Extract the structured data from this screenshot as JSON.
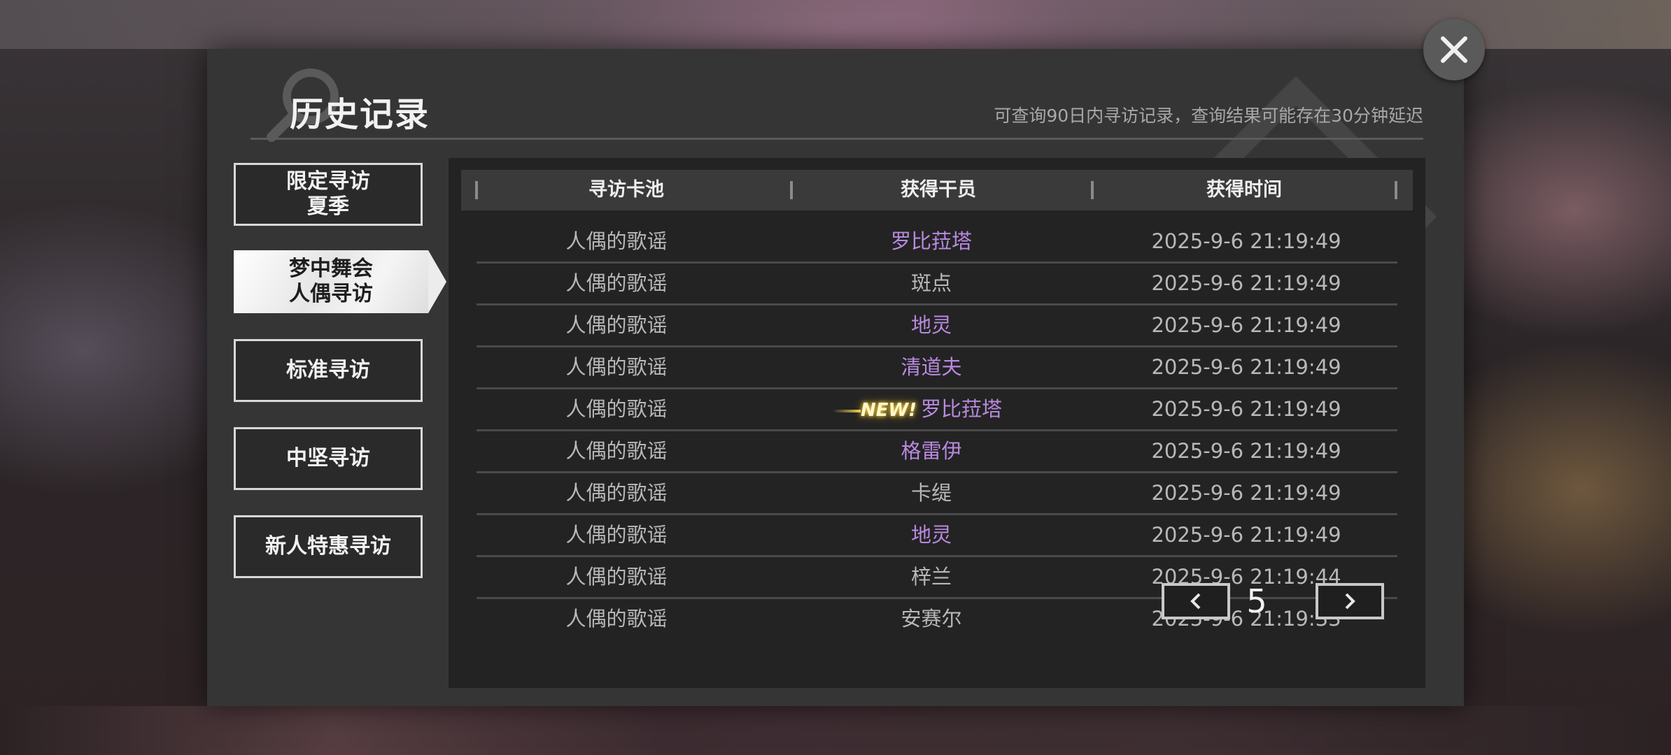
{
  "header": {
    "title": "历史记录",
    "subtitle": "可查询90日内寻访记录，查询结果可能存在30分钟延迟"
  },
  "tabs": [
    {
      "label": "限定寻访\n夏季",
      "active": false
    },
    {
      "label": "梦中舞会\n人偶寻访",
      "active": true
    },
    {
      "label": "标准寻访",
      "active": false
    },
    {
      "label": "中坚寻访",
      "active": false
    },
    {
      "label": "新人特惠寻访",
      "active": false
    }
  ],
  "table": {
    "columns": [
      "寻访卡池",
      "获得干员",
      "获得时间"
    ],
    "rows": [
      {
        "pool": "人偶的歌谣",
        "operator": "罗比菈塔",
        "time": "2025-9-6 21:19:49",
        "highlight": true,
        "new": false
      },
      {
        "pool": "人偶的歌谣",
        "operator": "斑点",
        "time": "2025-9-6 21:19:49",
        "highlight": false,
        "new": false
      },
      {
        "pool": "人偶的歌谣",
        "operator": "地灵",
        "time": "2025-9-6 21:19:49",
        "highlight": true,
        "new": false
      },
      {
        "pool": "人偶的歌谣",
        "operator": "清道夫",
        "time": "2025-9-6 21:19:49",
        "highlight": true,
        "new": false
      },
      {
        "pool": "人偶的歌谣",
        "operator": "罗比菈塔",
        "time": "2025-9-6 21:19:49",
        "highlight": true,
        "new": true
      },
      {
        "pool": "人偶的歌谣",
        "operator": "格雷伊",
        "time": "2025-9-6 21:19:49",
        "highlight": true,
        "new": false
      },
      {
        "pool": "人偶的歌谣",
        "operator": "卡缇",
        "time": "2025-9-6 21:19:49",
        "highlight": false,
        "new": false
      },
      {
        "pool": "人偶的歌谣",
        "operator": "地灵",
        "time": "2025-9-6 21:19:49",
        "highlight": true,
        "new": false
      },
      {
        "pool": "人偶的歌谣",
        "operator": "梓兰",
        "time": "2025-9-6 21:19:44",
        "highlight": false,
        "new": false
      },
      {
        "pool": "人偶的歌谣",
        "operator": "安赛尔",
        "time": "2025-9-6 21:19:33",
        "highlight": false,
        "new": false
      }
    ],
    "new_badge": "NEW!"
  },
  "pagination": {
    "page": "5"
  },
  "icons": {
    "close": "close-icon",
    "prev": "chevron-left-icon",
    "next": "chevron-right-icon"
  },
  "colors": {
    "highlight": "#b88ae0",
    "normal_text": "#b8b8b8"
  }
}
